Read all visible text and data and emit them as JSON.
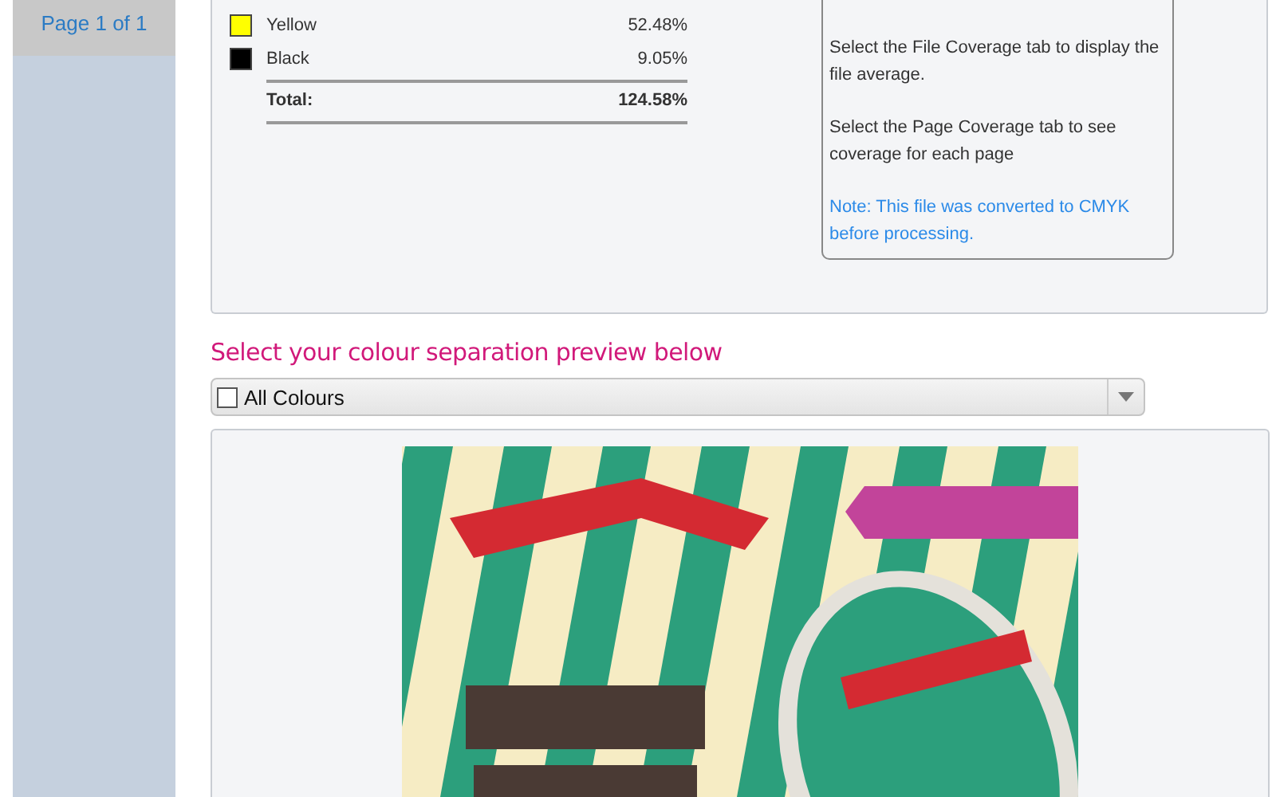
{
  "sidebar": {
    "items": [
      {
        "label": "Page 1 of 1",
        "selected": true
      }
    ]
  },
  "coverage": {
    "rows": [
      {
        "name": "Yellow",
        "value": "52.48%",
        "color": "#ffff00"
      },
      {
        "name": "Black",
        "value": "9.05%",
        "color": "#000000"
      }
    ],
    "total": {
      "label": "Total:",
      "value": "124.58%"
    }
  },
  "info": {
    "paragraphs": [
      {
        "text": "Select the File Coverage tab to display the file average.",
        "kind": "plain"
      },
      {
        "text": "Select the Page Coverage tab to see coverage for each page",
        "kind": "plain"
      },
      {
        "text": "Note: This file was converted to CMYK before processing.",
        "kind": "note"
      }
    ]
  },
  "separation": {
    "heading": "Select your colour separation preview below",
    "dropdown": {
      "value": "All Colours",
      "checked": false
    }
  }
}
